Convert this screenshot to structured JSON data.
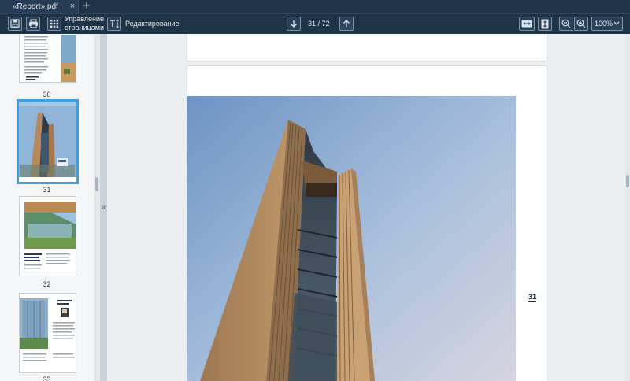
{
  "tab": {
    "title": "«Report».pdf",
    "close": "×",
    "new": "+"
  },
  "toolbar": {
    "manage_pages_label": "Управление\nстраницами",
    "editing_label": "Редактирование",
    "current_page": "31",
    "page_total": "/ 72",
    "zoom_value": "100%",
    "zoom_caret": "⌄"
  },
  "sidebar": {
    "collapse_glyph": "«",
    "thumbnails": [
      {
        "page": "30"
      },
      {
        "page": "31",
        "selected": true
      },
      {
        "page": "32"
      },
      {
        "page": "33"
      }
    ]
  },
  "document": {
    "page_marker": "31"
  },
  "colors": {
    "accent": "#3aa0e8",
    "toolbar_bg": "#1f3347"
  }
}
